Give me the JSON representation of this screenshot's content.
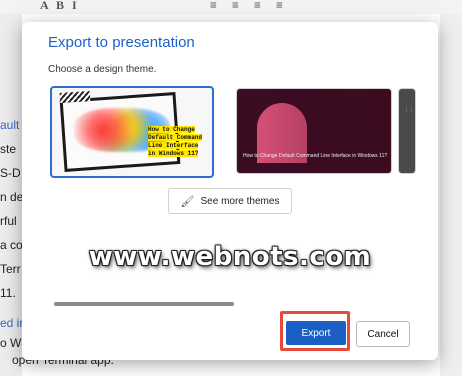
{
  "background_doc": {
    "toolbar_glyphs": [
      "A",
      "B",
      "I",
      "≡",
      "≡",
      "≡",
      "≡"
    ],
    "lines": [
      {
        "text": "ault",
        "color": "blue"
      },
      {
        "text": "ste",
        "color": "normal"
      },
      {
        "text": "S-D",
        "color": "normal"
      },
      {
        "text": "n de",
        "color": "normal"
      },
      {
        "text": "rful",
        "color": "normal"
      },
      {
        "text": "a co",
        "color": "normal"
      },
      {
        "text": "Terr",
        "color": "normal"
      },
      {
        "text": "11.",
        "color": "normal"
      },
      {
        "text": "ed in",
        "color": "blue"
      },
      {
        "text": "o W",
        "color": "normal"
      }
    ],
    "bottom_text": "open Terminal app."
  },
  "dialog": {
    "title": "Export to presentation",
    "subtitle": "Choose a design theme.",
    "themes": [
      {
        "name": "theme-colorful-splash",
        "text": "How to Change Default Command Line Interface in Windows 11?"
      },
      {
        "name": "theme-pink-arch",
        "text": "How to Change Default Command Line Interface in Windows 11?"
      },
      {
        "name": "theme-dark-partial",
        "text": "⋮⋮⋮⋮⋮"
      }
    ],
    "see_more_label": "See more themes",
    "watermark": "www.webnots.com",
    "export_label": "Export",
    "cancel_label": "Cancel"
  },
  "colors": {
    "accent": "#1c63c9",
    "export_bg": "#1a5fc4",
    "highlight": "#e74a3b"
  }
}
